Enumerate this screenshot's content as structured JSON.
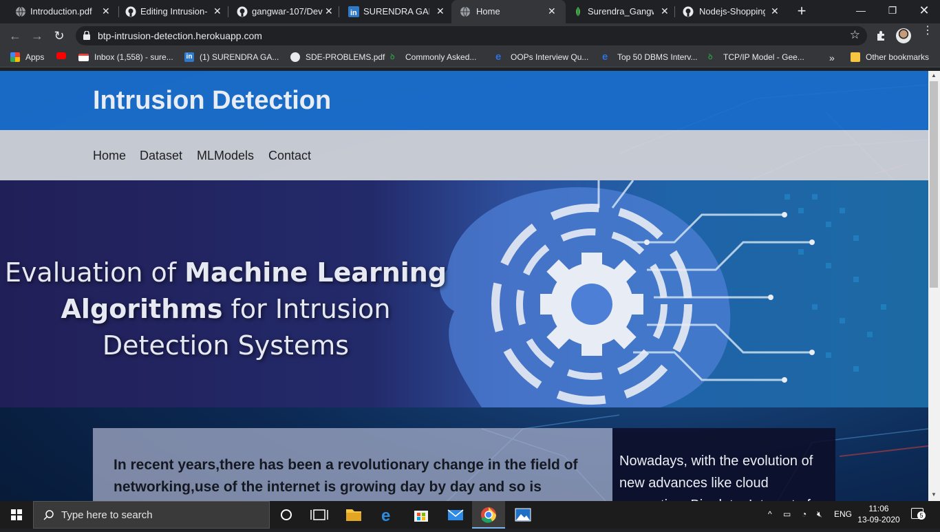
{
  "browser": {
    "tabs": [
      {
        "label": "Introduction.pdf",
        "icon": "globe-icon",
        "active": false
      },
      {
        "label": "Editing Intrusion-D",
        "icon": "github-icon",
        "active": false
      },
      {
        "label": "gangwar-107/Dev",
        "icon": "github-icon",
        "active": false
      },
      {
        "label": "SURENDRA GANG",
        "icon": "linkedin-icon",
        "active": false
      },
      {
        "label": "Home",
        "icon": "globe-icon",
        "active": true
      },
      {
        "label": "Surendra_Gangwa",
        "icon": "leaf-icon",
        "active": false
      },
      {
        "label": "Nodejs-Shopping-",
        "icon": "github-icon",
        "active": false
      }
    ],
    "url": "btp-intrusion-detection.herokuapp.com",
    "bookmarks": [
      {
        "label": "Apps",
        "icon": "apps-grid-icon"
      },
      {
        "label": "",
        "icon": "youtube-icon"
      },
      {
        "label": "Inbox (1,558) - sure...",
        "icon": "gmail-icon"
      },
      {
        "label": "(1) SURENDRA GA...",
        "icon": "linkedin-icon"
      },
      {
        "label": "SDE-PROBLEMS.pdf",
        "icon": "globe-icon"
      },
      {
        "label": "Commonly Asked...",
        "icon": "gfg-icon"
      },
      {
        "label": "OOPs Interview Qu...",
        "icon": "edge-icon"
      },
      {
        "label": "Top 50 DBMS Interv...",
        "icon": "edge-icon"
      },
      {
        "label": "TCP/IP Model - Gee...",
        "icon": "gfg-icon"
      }
    ],
    "overflow_label": "»",
    "other_bookmarks": "Other bookmarks"
  },
  "site": {
    "title": "Intrusion Detection",
    "nav": [
      "Home",
      "Dataset",
      "MLModels",
      "Contact"
    ],
    "banner": {
      "line1_normal": "Evaluation of ",
      "line1_bold": "Machine Learning",
      "line2_bold": "Algorithms",
      "line2_normal": " for Intrusion",
      "line3": "Detection Systems"
    },
    "left_text": "In recent years,there has been a revolutionary change in the field of networking,use of the internet is growing day by day and so is",
    "right_text": "Nowadays, with the evolution of new advances like cloud computing, Big data, Internet of"
  },
  "taskbar": {
    "search_placeholder": "Type here to search",
    "language": "ENG",
    "time": "11:06",
    "date": "13-09-2020",
    "notification_count": "5"
  },
  "colors": {
    "header_blue": "#1b71d1",
    "nav_gray": "#d6d8de",
    "chrome_dark": "#202124",
    "chrome_toolbar": "#35363a"
  }
}
